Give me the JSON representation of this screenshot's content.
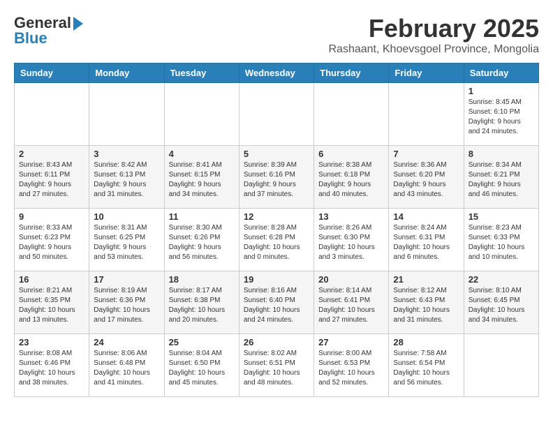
{
  "logo": {
    "general": "General",
    "blue": "Blue"
  },
  "title": "February 2025",
  "subtitle": "Rashaant, Khoevsgoel Province, Mongolia",
  "days_of_week": [
    "Sunday",
    "Monday",
    "Tuesday",
    "Wednesday",
    "Thursday",
    "Friday",
    "Saturday"
  ],
  "weeks": [
    [
      {
        "day": "",
        "info": ""
      },
      {
        "day": "",
        "info": ""
      },
      {
        "day": "",
        "info": ""
      },
      {
        "day": "",
        "info": ""
      },
      {
        "day": "",
        "info": ""
      },
      {
        "day": "",
        "info": ""
      },
      {
        "day": "1",
        "info": "Sunrise: 8:45 AM\nSunset: 6:10 PM\nDaylight: 9 hours and 24 minutes."
      }
    ],
    [
      {
        "day": "2",
        "info": "Sunrise: 8:43 AM\nSunset: 6:11 PM\nDaylight: 9 hours and 27 minutes."
      },
      {
        "day": "3",
        "info": "Sunrise: 8:42 AM\nSunset: 6:13 PM\nDaylight: 9 hours and 31 minutes."
      },
      {
        "day": "4",
        "info": "Sunrise: 8:41 AM\nSunset: 6:15 PM\nDaylight: 9 hours and 34 minutes."
      },
      {
        "day": "5",
        "info": "Sunrise: 8:39 AM\nSunset: 6:16 PM\nDaylight: 9 hours and 37 minutes."
      },
      {
        "day": "6",
        "info": "Sunrise: 8:38 AM\nSunset: 6:18 PM\nDaylight: 9 hours and 40 minutes."
      },
      {
        "day": "7",
        "info": "Sunrise: 8:36 AM\nSunset: 6:20 PM\nDaylight: 9 hours and 43 minutes."
      },
      {
        "day": "8",
        "info": "Sunrise: 8:34 AM\nSunset: 6:21 PM\nDaylight: 9 hours and 46 minutes."
      }
    ],
    [
      {
        "day": "9",
        "info": "Sunrise: 8:33 AM\nSunset: 6:23 PM\nDaylight: 9 hours and 50 minutes."
      },
      {
        "day": "10",
        "info": "Sunrise: 8:31 AM\nSunset: 6:25 PM\nDaylight: 9 hours and 53 minutes."
      },
      {
        "day": "11",
        "info": "Sunrise: 8:30 AM\nSunset: 6:26 PM\nDaylight: 9 hours and 56 minutes."
      },
      {
        "day": "12",
        "info": "Sunrise: 8:28 AM\nSunset: 6:28 PM\nDaylight: 10 hours and 0 minutes."
      },
      {
        "day": "13",
        "info": "Sunrise: 8:26 AM\nSunset: 6:30 PM\nDaylight: 10 hours and 3 minutes."
      },
      {
        "day": "14",
        "info": "Sunrise: 8:24 AM\nSunset: 6:31 PM\nDaylight: 10 hours and 6 minutes."
      },
      {
        "day": "15",
        "info": "Sunrise: 8:23 AM\nSunset: 6:33 PM\nDaylight: 10 hours and 10 minutes."
      }
    ],
    [
      {
        "day": "16",
        "info": "Sunrise: 8:21 AM\nSunset: 6:35 PM\nDaylight: 10 hours and 13 minutes."
      },
      {
        "day": "17",
        "info": "Sunrise: 8:19 AM\nSunset: 6:36 PM\nDaylight: 10 hours and 17 minutes."
      },
      {
        "day": "18",
        "info": "Sunrise: 8:17 AM\nSunset: 6:38 PM\nDaylight: 10 hours and 20 minutes."
      },
      {
        "day": "19",
        "info": "Sunrise: 8:16 AM\nSunset: 6:40 PM\nDaylight: 10 hours and 24 minutes."
      },
      {
        "day": "20",
        "info": "Sunrise: 8:14 AM\nSunset: 6:41 PM\nDaylight: 10 hours and 27 minutes."
      },
      {
        "day": "21",
        "info": "Sunrise: 8:12 AM\nSunset: 6:43 PM\nDaylight: 10 hours and 31 minutes."
      },
      {
        "day": "22",
        "info": "Sunrise: 8:10 AM\nSunset: 6:45 PM\nDaylight: 10 hours and 34 minutes."
      }
    ],
    [
      {
        "day": "23",
        "info": "Sunrise: 8:08 AM\nSunset: 6:46 PM\nDaylight: 10 hours and 38 minutes."
      },
      {
        "day": "24",
        "info": "Sunrise: 8:06 AM\nSunset: 6:48 PM\nDaylight: 10 hours and 41 minutes."
      },
      {
        "day": "25",
        "info": "Sunrise: 8:04 AM\nSunset: 6:50 PM\nDaylight: 10 hours and 45 minutes."
      },
      {
        "day": "26",
        "info": "Sunrise: 8:02 AM\nSunset: 6:51 PM\nDaylight: 10 hours and 48 minutes."
      },
      {
        "day": "27",
        "info": "Sunrise: 8:00 AM\nSunset: 6:53 PM\nDaylight: 10 hours and 52 minutes."
      },
      {
        "day": "28",
        "info": "Sunrise: 7:58 AM\nSunset: 6:54 PM\nDaylight: 10 hours and 56 minutes."
      },
      {
        "day": "",
        "info": ""
      }
    ]
  ]
}
